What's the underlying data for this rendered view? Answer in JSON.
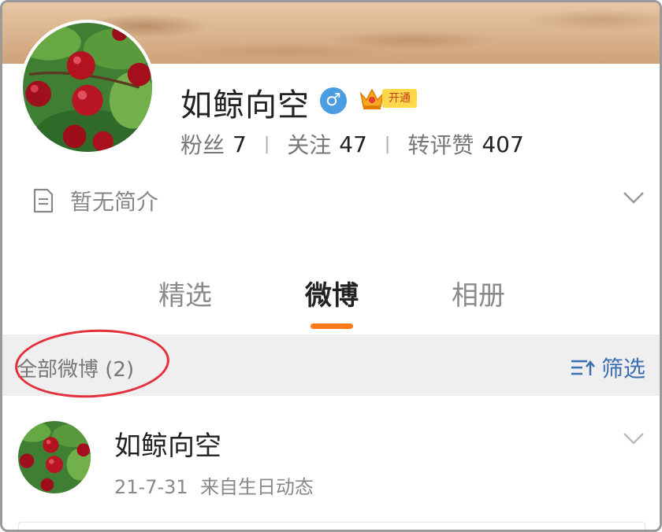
{
  "profile": {
    "name": "如鲸向空",
    "gender_symbol": "♂",
    "vip_label": "开通",
    "stats": [
      {
        "label": "粉丝",
        "value": "7"
      },
      {
        "label": "关注",
        "value": "47"
      },
      {
        "label": "转评赞",
        "value": "407"
      }
    ],
    "bio": "暂无简介"
  },
  "tabs": [
    {
      "label": "精选",
      "active": false
    },
    {
      "label": "微博",
      "active": true
    },
    {
      "label": "相册",
      "active": false
    }
  ],
  "filter_bar": {
    "count_text": "全部微博 (2)",
    "filter_label": "筛选"
  },
  "post": {
    "author": "如鲸向空",
    "date": "21-7-31",
    "source": "来自生日动态"
  },
  "colors": {
    "accent_underline": "#ff7a1a",
    "link_blue": "#3b6fb0",
    "annotation_red": "#e4303c",
    "gender_blue": "#4a9de0"
  },
  "icons": [
    "avatar-apple-image",
    "male-icon",
    "vip-crown-icon",
    "document-icon",
    "chevron-down-icon",
    "filter-sort-icon"
  ]
}
